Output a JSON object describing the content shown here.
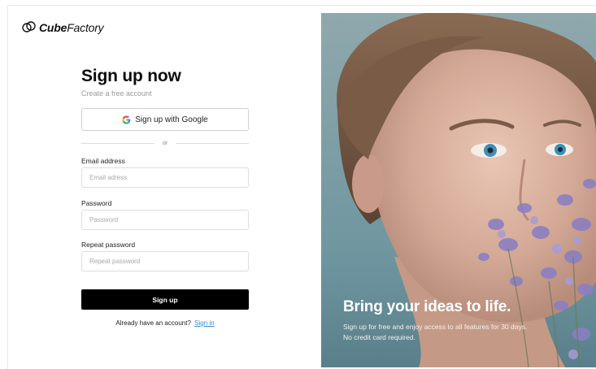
{
  "brand": {
    "name_bold": "Cube",
    "name_rest": "Factory"
  },
  "form": {
    "title": "Sign up now",
    "subtitle": "Create a free account",
    "google_label": "Sign up with Google",
    "divider_text": "or",
    "email_label": "Email address",
    "email_placeholder": "Email adress",
    "email_value": "",
    "password_label": "Password",
    "password_placeholder": "Password",
    "password_value": "",
    "repeat_label": "Repeat password",
    "repeat_placeholder": "Repeat password",
    "repeat_value": "",
    "submit_label": "Sign up",
    "already_text": "Already have an account?",
    "signin_link": "Sign in"
  },
  "hero": {
    "headline": "Bring your ideas to life.",
    "subtext": "Sign up for free and enjoy access to all features for 30 days. No credit card required."
  },
  "colors": {
    "accent_link": "#2f8fd8",
    "button": "#000000"
  }
}
